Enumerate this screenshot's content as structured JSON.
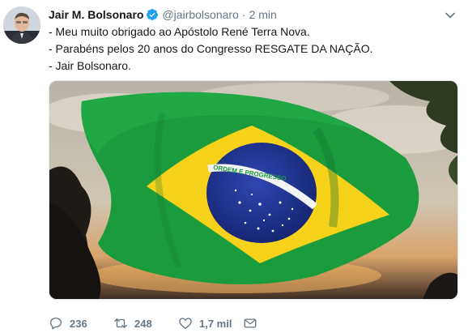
{
  "tweet": {
    "author_name": "Jair M. Bolsonaro",
    "handle": "@jairbolsonaro",
    "separator": "·",
    "time": "2 min",
    "lines": [
      "- Meu muito obrigado ao Apóstolo René Terra Nova.",
      "- Parabéns pelos 20 anos do Congresso RESGATE DA NAÇÃO.",
      "- Jair Bolsonaro."
    ],
    "flag_motto": "ORDEM E PROGRESSO",
    "counts": {
      "replies": "236",
      "retweets": "248",
      "likes": "1,7 mil"
    },
    "colors": {
      "verified": "#1da1f2",
      "flag_green": "#1a9c3c",
      "flag_yellow": "#f6d21a",
      "flag_blue": "#1c2f8a",
      "muted": "#657786"
    },
    "icons": [
      "verified-badge-icon",
      "caret-down-icon",
      "reply-icon",
      "retweet-icon",
      "like-icon",
      "dm-icon"
    ]
  }
}
